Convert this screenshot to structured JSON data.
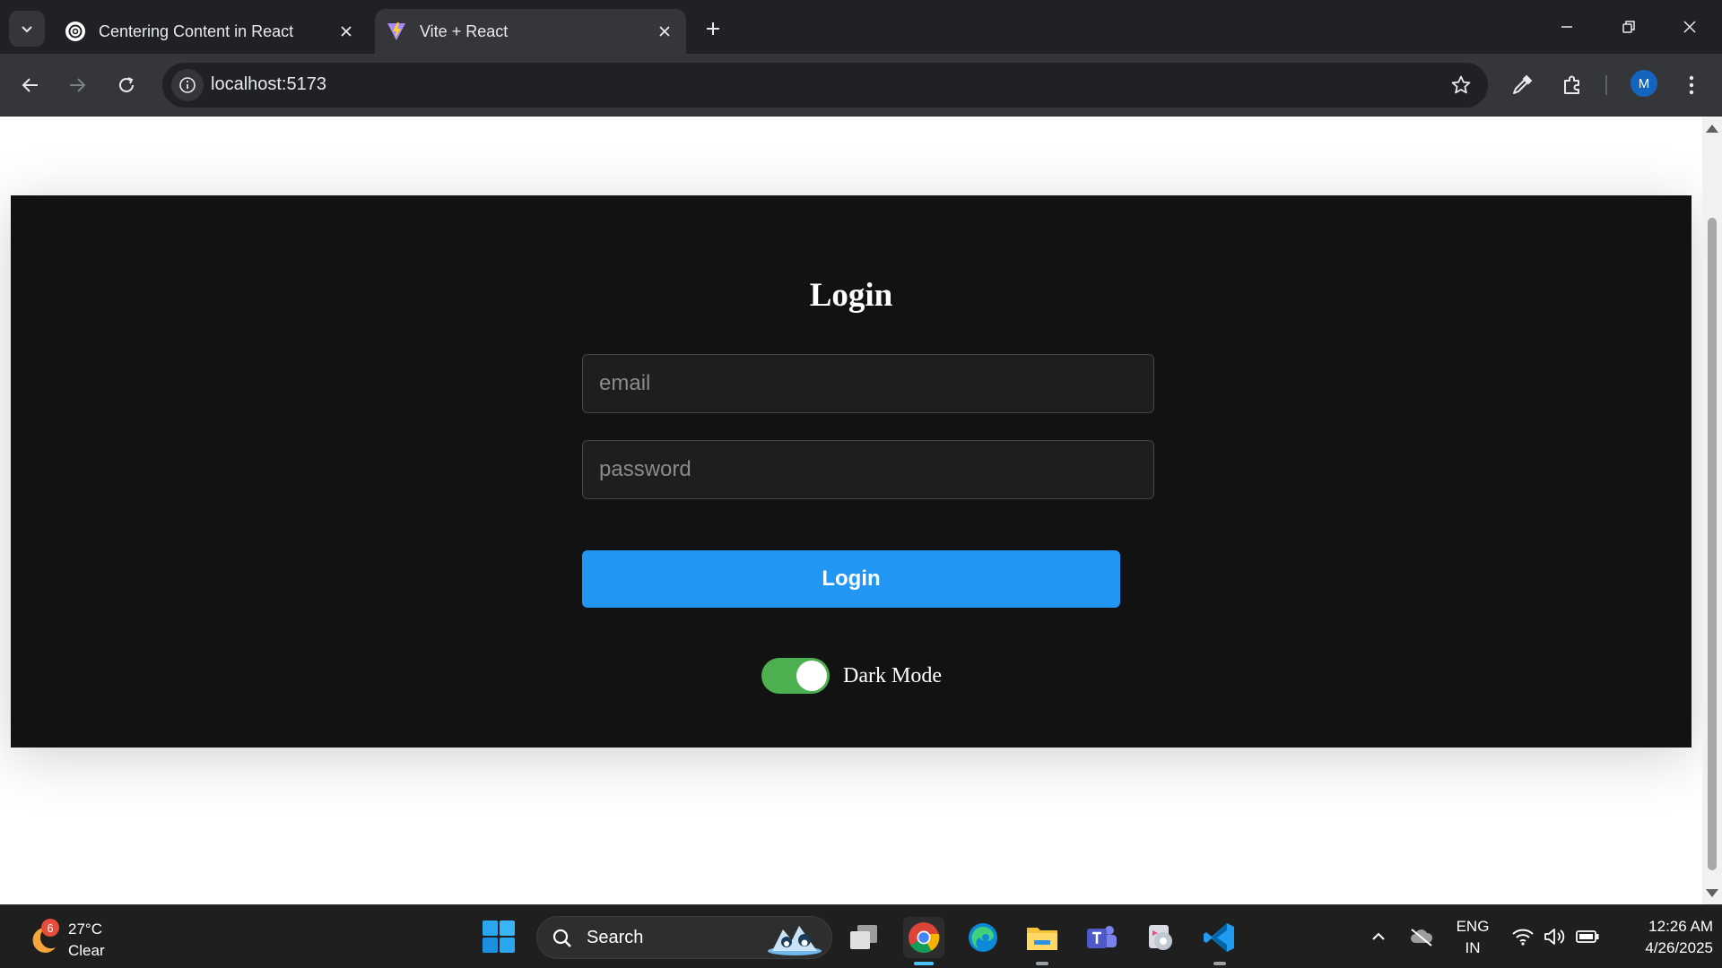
{
  "browser": {
    "tabs": [
      {
        "title": "Centering Content in React",
        "active": false,
        "favicon": "chatgpt-icon"
      },
      {
        "title": "Vite + React",
        "active": true,
        "favicon": "vite-icon"
      }
    ],
    "address": "localhost:5173",
    "profile_initial": "M"
  },
  "page": {
    "title": "Login",
    "email_placeholder": "email",
    "password_placeholder": "password",
    "login_button": "Login",
    "toggle_label": "Dark Mode",
    "toggle_on": true
  },
  "taskbar": {
    "weather": {
      "badge": "6",
      "temperature": "27°C",
      "condition": "Clear"
    },
    "search_label": "Search",
    "apps": [
      "task-view",
      "chrome",
      "edge",
      "file-explorer",
      "teams",
      "media-player",
      "vscode"
    ],
    "language": {
      "line1": "ENG",
      "line2": "IN"
    },
    "time": "12:26 AM",
    "date": "4/26/2025"
  },
  "colors": {
    "accent": "#2196f3",
    "toggle": "#4caf50",
    "app_background": "#121212",
    "chrome_dark": "#202124"
  }
}
